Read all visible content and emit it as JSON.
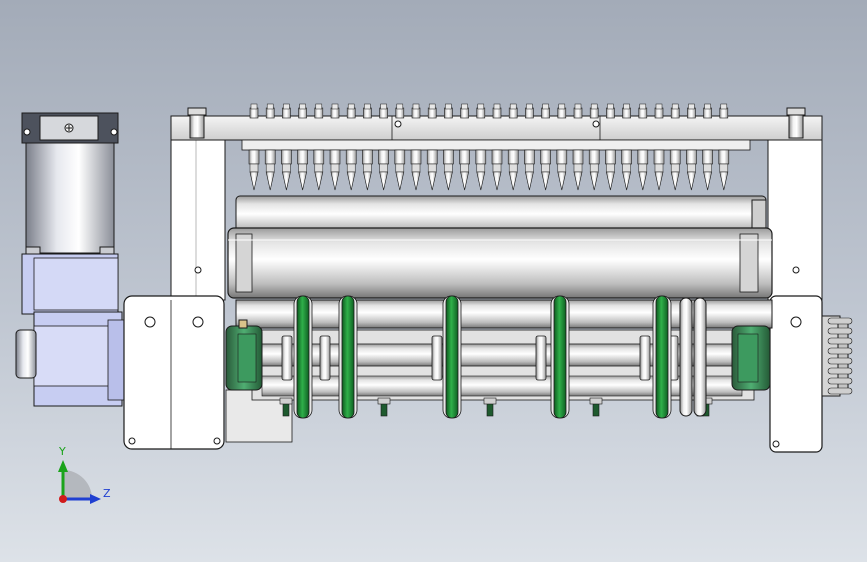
{
  "triad": {
    "y_label": "Y",
    "z_label": "Z"
  },
  "model": {
    "upper_needle_count": 30,
    "lower_needle_count": 30,
    "green_ring_count": 5,
    "lower_peg_count": 6,
    "colors": {
      "metal": "#d9d9d9",
      "frame": "#ffffff",
      "green": "#1e8a35",
      "motor_blue": "#c7cdf2",
      "outline": "#1a1a1a"
    }
  }
}
